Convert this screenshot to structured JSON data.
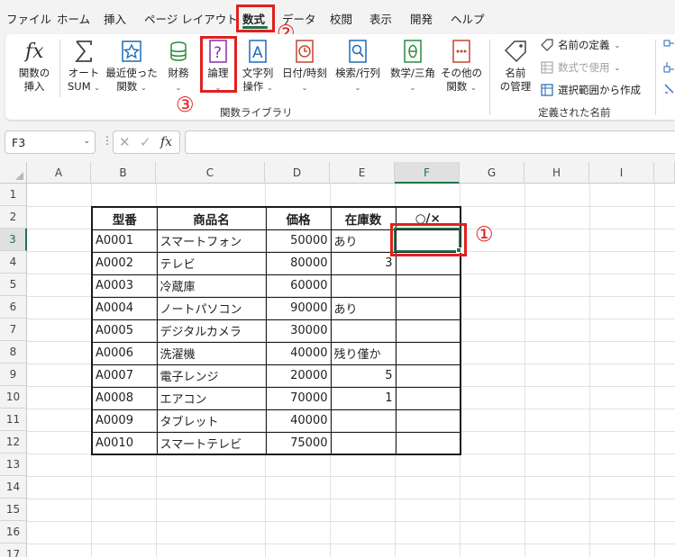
{
  "menu": {
    "items": [
      "ファイル",
      "ホーム",
      "挿入",
      "ページ レイアウト",
      "数式",
      "データ",
      "校閲",
      "表示",
      "開発",
      "ヘルプ"
    ],
    "active_index": 4
  },
  "ribbon": {
    "insert_function": {
      "line1": "関数の",
      "line2": "挿入"
    },
    "autosum": {
      "line1": "オート",
      "line2": "SUM"
    },
    "recent": {
      "line1": "最近使った",
      "line2": "関数"
    },
    "financial": {
      "line1": "財務"
    },
    "logical": {
      "line1": "論理"
    },
    "text": {
      "line1": "文字列",
      "line2": "操作"
    },
    "datetime": {
      "line1": "日付/時刻"
    },
    "lookup": {
      "line1": "検索/行列"
    },
    "math": {
      "line1": "数学/三角"
    },
    "more": {
      "line1": "その他の",
      "line2": "関数"
    },
    "library_label": "関数ライブラリ",
    "name_manager": {
      "line1": "名前",
      "line2": "の管理"
    },
    "define_name": "名前の定義",
    "use_in_formula": "数式で使用",
    "create_from_selection": "選択範囲から作成",
    "defined_names_label": "定義された名前"
  },
  "annotations": {
    "one": "①",
    "two": "②",
    "three": "③"
  },
  "formula_bar": {
    "name_box": "F3",
    "fx": "fx",
    "formula": ""
  },
  "columns": [
    "A",
    "B",
    "C",
    "D",
    "E",
    "F",
    "G",
    "H",
    "I"
  ],
  "rows": [
    "1",
    "2",
    "3",
    "4",
    "5",
    "6",
    "7",
    "8",
    "9",
    "10",
    "11",
    "12",
    "13",
    "14",
    "15",
    "16",
    "17"
  ],
  "table": {
    "headers": [
      "型番",
      "商品名",
      "価格",
      "在庫数",
      "○/×"
    ],
    "rows": [
      [
        "A0001",
        "スマートフォン",
        "50000",
        "あり",
        ""
      ],
      [
        "A0002",
        "テレビ",
        "80000",
        "3",
        ""
      ],
      [
        "A0003",
        "冷蔵庫",
        "60000",
        "",
        ""
      ],
      [
        "A0004",
        "ノートパソコン",
        "90000",
        "あり",
        ""
      ],
      [
        "A0005",
        "デジタルカメラ",
        "30000",
        "",
        ""
      ],
      [
        "A0006",
        "洗濯機",
        "40000",
        "残り僅か",
        ""
      ],
      [
        "A0007",
        "電子レンジ",
        "20000",
        "5",
        ""
      ],
      [
        "A0008",
        "エアコン",
        "70000",
        "1",
        ""
      ],
      [
        "A0009",
        "タブレット",
        "40000",
        "",
        ""
      ],
      [
        "A0010",
        "スマートテレビ",
        "75000",
        "",
        ""
      ]
    ]
  },
  "colors": {
    "accent": "#217346",
    "highlight": "#e02020"
  }
}
